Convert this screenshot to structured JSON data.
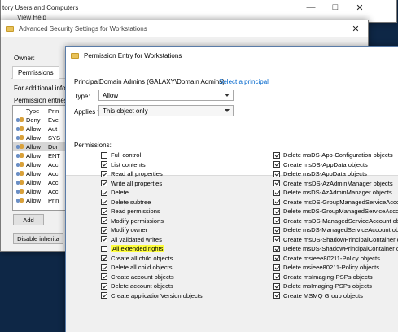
{
  "back_window": {
    "title": "tory Users and Computers",
    "menu": "View  Help"
  },
  "middle_window": {
    "title": "Advanced Security Settings for Workstations",
    "owner_label": "Owner:",
    "tab": "Permissions",
    "info_text": "For additional info",
    "entries_label": "Permission entries",
    "columns": {
      "type": "Type",
      "principal": "Prin"
    },
    "rows": [
      {
        "type": "Deny",
        "principal": "Eve"
      },
      {
        "type": "Allow",
        "principal": "Aut"
      },
      {
        "type": "Allow",
        "principal": "SYS"
      },
      {
        "type": "Allow",
        "principal": "Dor"
      },
      {
        "type": "Allow",
        "principal": "ENT"
      },
      {
        "type": "Allow",
        "principal": "Acc"
      },
      {
        "type": "Allow",
        "principal": "Acc"
      },
      {
        "type": "Allow",
        "principal": "Acc"
      },
      {
        "type": "Allow",
        "principal": "Acc"
      },
      {
        "type": "Allow",
        "principal": "Prin"
      }
    ],
    "selected_row": 3,
    "add_button": "Add",
    "disable_button": "Disable inherita"
  },
  "entry_window": {
    "title": "Permission Entry for Workstations",
    "principal_label": "Principal:",
    "principal_value": "Domain Admins (GALAXY\\Domain Admins)",
    "select_principal": "Select a principal",
    "type_label": "Type:",
    "type_value": "Allow",
    "applies_label": "Applies to:",
    "applies_value": "This object only",
    "permissions_label": "Permissions:",
    "left_permissions": [
      {
        "label": "Full control",
        "checked": false
      },
      {
        "label": "List contents",
        "checked": true
      },
      {
        "label": "Read all properties",
        "checked": true
      },
      {
        "label": "Write all properties",
        "checked": true
      },
      {
        "label": "Delete",
        "checked": true
      },
      {
        "label": "Delete subtree",
        "checked": true
      },
      {
        "label": "Read permissions",
        "checked": true
      },
      {
        "label": "Modify permissions",
        "checked": true
      },
      {
        "label": "Modify owner",
        "checked": true
      },
      {
        "label": "All validated writes",
        "checked": true
      },
      {
        "label": "All extended rights",
        "checked": false,
        "highlight": true
      },
      {
        "label": "Create all child objects",
        "checked": true
      },
      {
        "label": "Delete all child objects",
        "checked": true
      },
      {
        "label": "Create account objects",
        "checked": true
      },
      {
        "label": "Delete account objects",
        "checked": true
      },
      {
        "label": "Create applicationVersion objects",
        "checked": true
      }
    ],
    "right_permissions": [
      {
        "label": "Delete msDS-App-Configuration objects",
        "checked": true
      },
      {
        "label": "Create msDS-AppData objects",
        "checked": true
      },
      {
        "label": "Delete msDS-AppData objects",
        "checked": true
      },
      {
        "label": "Create msDS-AzAdminManager objects",
        "checked": true
      },
      {
        "label": "Delete msDS-AzAdminManager objects",
        "checked": true
      },
      {
        "label": "Create msDS-GroupManagedServiceAccount objects",
        "checked": true
      },
      {
        "label": "Delete msDS-GroupManagedServiceAccount objects",
        "checked": true
      },
      {
        "label": "Create msDS-ManagedServiceAccount objects",
        "checked": true
      },
      {
        "label": "Delete msDS-ManagedServiceAccount objects",
        "checked": true
      },
      {
        "label": "Create msDS-ShadowPrincipalContainer objects",
        "checked": true
      },
      {
        "label": "Delete msDS-ShadowPrincipalContainer objects",
        "checked": true
      },
      {
        "label": "Create msieee80211-Policy objects",
        "checked": true
      },
      {
        "label": "Delete msieee80211-Policy objects",
        "checked": true
      },
      {
        "label": "Create msImaging-PSPs objects",
        "checked": true
      },
      {
        "label": "Delete msImaging-PSPs objects",
        "checked": true
      },
      {
        "label": "Create MSMQ Group objects",
        "checked": true
      }
    ]
  }
}
